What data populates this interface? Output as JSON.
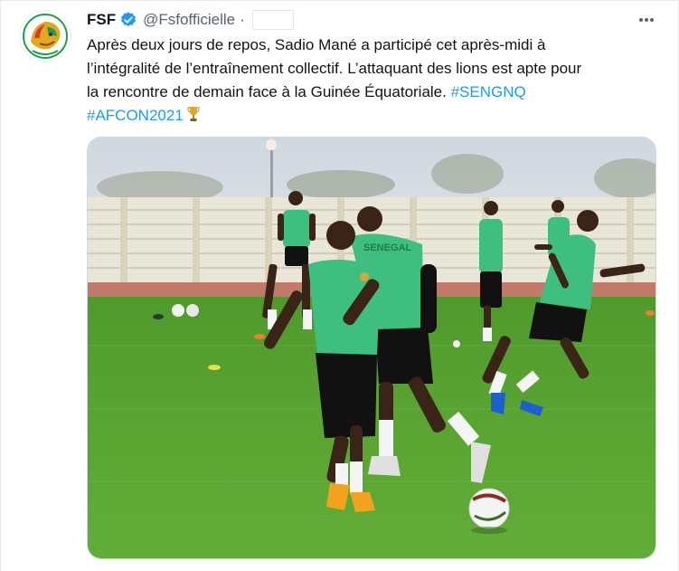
{
  "author": {
    "display_name": "FSF",
    "handle": "@Fsfofficielle",
    "separator": "·",
    "verified_icon": "verified-badge-icon",
    "avatar_icon": "fsf-lion-logo"
  },
  "menu": {
    "more_icon": "more-horizontal-icon"
  },
  "tweet": {
    "line1": "Après deux jours de repos, Sadio Mané a participé cet après-midi à",
    "line2": "l’intégralité de l’entraînement collectif. L’attaquant des lions est apte pour",
    "line3_text": "la rencontre de demain face à la Guinée Équatoriale. ",
    "hashtag1": "#SENGNQ",
    "hashtag2": "#AFCON2021",
    "emoji_icon": "trophy-icon"
  },
  "media": {
    "shirt_text": "SENEGAL",
    "colors": {
      "pitch": "#4f9a2c",
      "jersey": "#3fbf7f",
      "shorts": "#111111",
      "track": "#c47a6a",
      "sky": "#d5dde6",
      "hashtag": "#1d9bf0"
    }
  }
}
